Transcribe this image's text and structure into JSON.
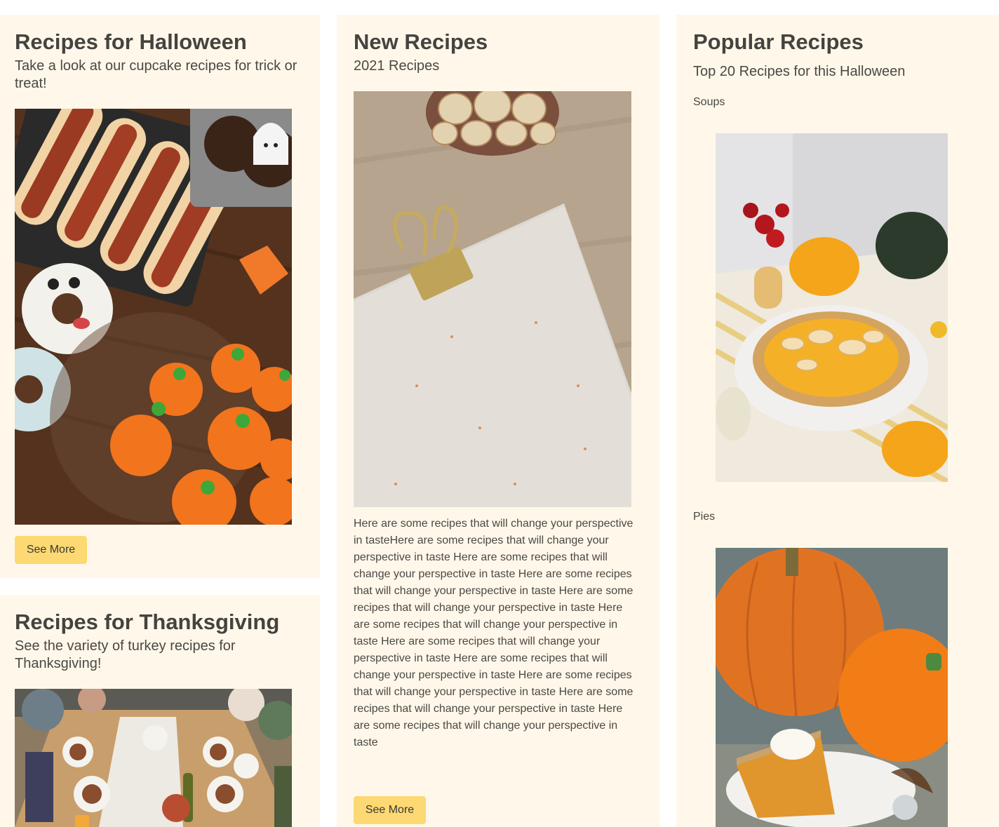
{
  "halloween": {
    "title": "Recipes for Halloween",
    "subtitle": "Take a look at our cupcake recipes for trick or treat!",
    "button": "See More"
  },
  "thanksgiving": {
    "title": "Recipes for Thanksgiving",
    "subtitle": "See the variety of turkey recipes for Thanksgiving!"
  },
  "new_recipes": {
    "title": "New Recipes",
    "subtitle": "2021 Recipes",
    "body": "Here are some recipes that will change your perspective in tasteHere are some recipes that will change your perspective in taste Here are some recipes that will change your perspective in taste Here are some recipes that will change your perspective in taste Here are some recipes that will change your perspective in taste Here are some recipes that will change your perspective in taste Here are some recipes that will change your perspective in taste Here are some recipes that will change your perspective in taste Here are some recipes that will change your perspective in taste Here are some recipes that will change your perspective in taste Here are some recipes that will change your perspective in taste",
    "button": "See More"
  },
  "popular": {
    "title": "Popular Recipes",
    "subtitle": "Top 20 Recipes for this Halloween",
    "categories": [
      "Soups",
      "Pies"
    ]
  },
  "colors": {
    "card_background": "#fff8ea",
    "button_background": "#fcd973",
    "heading_text": "#45433f"
  }
}
